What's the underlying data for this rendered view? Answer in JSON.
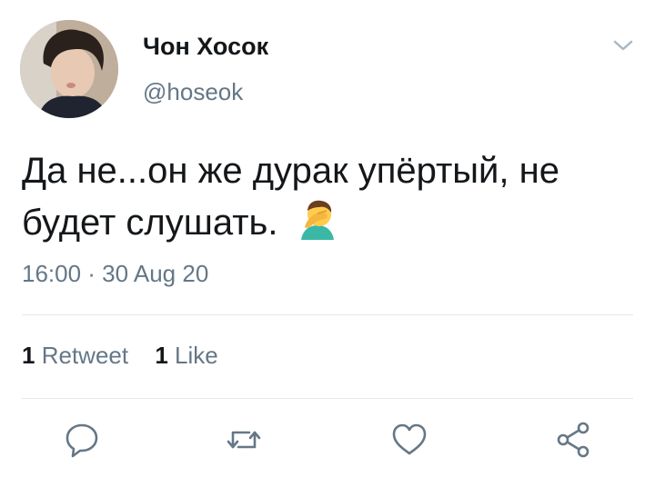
{
  "user": {
    "display_name": "Чон Хосок",
    "handle": "@hoseok"
  },
  "tweet": {
    "text": "Да не...он же дурак упёртый, не будет слушать.",
    "emoji": "face-palm-emoji",
    "timestamp": "16:00 · 30 Aug 20"
  },
  "stats": {
    "retweets_count": "1",
    "retweets_label": "Retweet",
    "likes_count": "1",
    "likes_label": "Like"
  },
  "icons": {
    "menu": "chevron-down-icon",
    "reply": "reply-icon",
    "retweet": "retweet-icon",
    "like": "heart-icon",
    "share": "share-icon"
  },
  "colors": {
    "text": "#14171a",
    "secondary": "#657786",
    "divider": "#e1e8ed"
  }
}
